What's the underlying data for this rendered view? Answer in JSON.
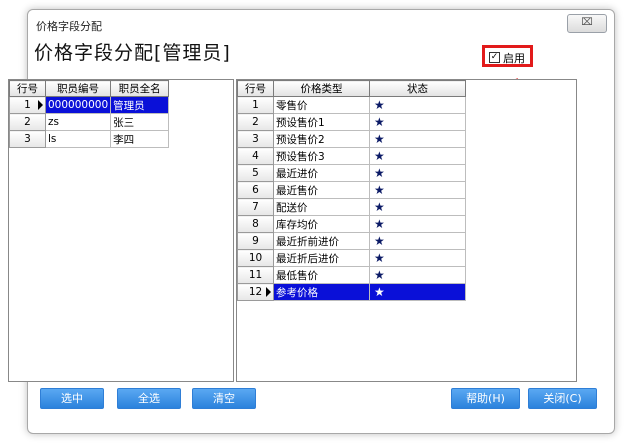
{
  "window": {
    "title": "价格字段分配",
    "close_label": "⌧"
  },
  "header": {
    "title": "价格字段分配[管理员]"
  },
  "enable": {
    "label": "启用",
    "checked": true,
    "check_glyph": "✓"
  },
  "employees": {
    "columns": [
      "行号",
      "职员编号",
      "职员全名"
    ],
    "rows": [
      {
        "row": "1",
        "code": "000000000",
        "name": "管理员",
        "selected": true
      },
      {
        "row": "2",
        "code": "zs",
        "name": "张三",
        "selected": false
      },
      {
        "row": "3",
        "code": "ls",
        "name": "李四",
        "selected": false
      }
    ]
  },
  "prices": {
    "columns": [
      "行号",
      "价格类型",
      "状态"
    ],
    "status_glyph": "★",
    "rows": [
      {
        "row": "1",
        "type": "零售价",
        "selected": false
      },
      {
        "row": "2",
        "type": "预设售价1",
        "selected": false
      },
      {
        "row": "3",
        "type": "预设售价2",
        "selected": false
      },
      {
        "row": "4",
        "type": "预设售价3",
        "selected": false
      },
      {
        "row": "5",
        "type": "最近进价",
        "selected": false
      },
      {
        "row": "6",
        "type": "最近售价",
        "selected": false
      },
      {
        "row": "7",
        "type": "配送价",
        "selected": false
      },
      {
        "row": "8",
        "type": "库存均价",
        "selected": false
      },
      {
        "row": "9",
        "type": "最近折前进价",
        "selected": false
      },
      {
        "row": "10",
        "type": "最近折后进价",
        "selected": false
      },
      {
        "row": "11",
        "type": "最低售价",
        "selected": false
      },
      {
        "row": "12",
        "type": "参考价格",
        "selected": true
      }
    ]
  },
  "buttons": {
    "select": "选中",
    "select_all": "全选",
    "clear": "清空",
    "help": "帮助(H)",
    "close": "关闭(C)"
  },
  "colors": {
    "highlight": "#e21a1a",
    "selection": "#0a10d8",
    "button": "#2b82dc"
  }
}
